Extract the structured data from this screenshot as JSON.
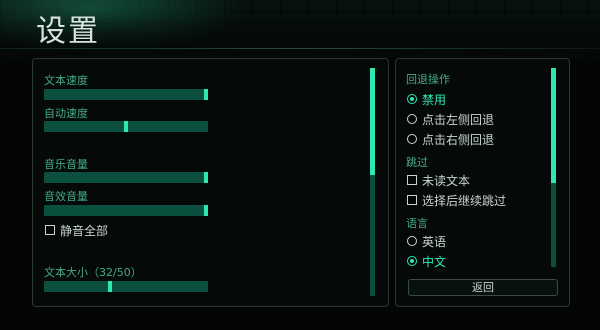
{
  "screen": {
    "title": "设置"
  },
  "left": {
    "text_speed": {
      "label": "文本速度",
      "level": 1.0
    },
    "auto_speed": {
      "label": "自动速度",
      "level": 0.5
    },
    "music_volume": {
      "label": "音乐音量",
      "level": 1.0
    },
    "sfx_volume": {
      "label": "音效音量",
      "level": 1.0
    },
    "mute_all": {
      "label": "静音全部",
      "checked": false
    },
    "text_size": {
      "label": "文本大小（32/50）",
      "level": 0.4
    }
  },
  "right": {
    "rollback": {
      "heading": "回退操作",
      "options": [
        {
          "label": "禁用",
          "selected": true
        },
        {
          "label": "点击左侧回退",
          "selected": false
        },
        {
          "label": "点击右侧回退",
          "selected": false
        }
      ]
    },
    "skip": {
      "heading": "跳过",
      "options": [
        {
          "label": "未读文本",
          "checked": false
        },
        {
          "label": "选择后继续跳过",
          "checked": false
        }
      ]
    },
    "language": {
      "heading": "语言",
      "options": [
        {
          "label": "英语",
          "selected": false
        },
        {
          "label": "中文",
          "selected": true
        }
      ]
    },
    "back_label": "返回"
  },
  "colors": {
    "accent": "#2ee8b4",
    "track": "#0b4f3e",
    "label": "#45a98c",
    "text": "#c8d4cf"
  },
  "scrollbars": {
    "left_position": 0.0,
    "right_position": 0.0
  }
}
